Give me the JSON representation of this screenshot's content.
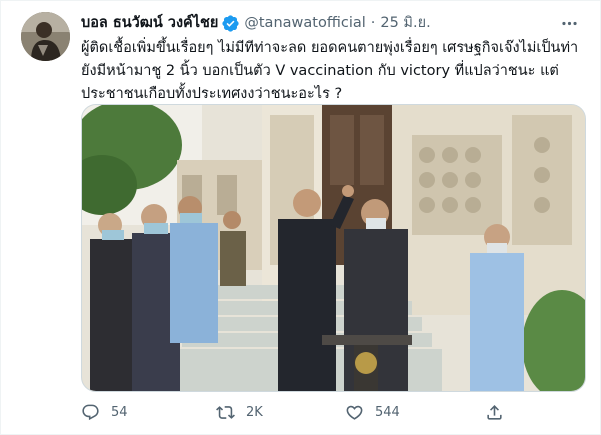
{
  "tweet": {
    "author": {
      "display_name": "บอล ธนวัฒน์ วงค์ไชย",
      "handle": "@tanawatofficial",
      "verified": true,
      "avatar_icon": "profile-photo"
    },
    "date": "25 มิ.ย.",
    "separator": "·",
    "more_icon": "more-horizontal-icon",
    "text_lines": [
      "ผู้ติดเชื้อเพิ่มขึ้นเรื่อยๆ ไม่มีทีท่าจะลด ยอดคนตายพุ่งเรื่อยๆ เศรษฐกิจเจ๊งไม่เป็นท่า",
      "ยังมีหน้ามาชู 2 นิ้ว บอกเป็นตัว V vaccination กับ victory ที่แปลว่าชนะ แต่",
      "ประชาชนเกือบทั้งประเทศงงว่าชนะอะไร ?"
    ],
    "media": {
      "type": "photo",
      "description_icon": "press-conference-photo"
    },
    "actions": {
      "reply": {
        "icon": "reply-icon",
        "count": "54"
      },
      "retweet": {
        "icon": "retweet-icon",
        "count": "2K"
      },
      "like": {
        "icon": "heart-icon",
        "count": "544"
      },
      "share": {
        "icon": "share-icon",
        "count": ""
      }
    },
    "colors": {
      "text": "#0f1419",
      "secondary": "#536471",
      "verified": "#1d9bf0",
      "border": "#cfd9de"
    }
  }
}
